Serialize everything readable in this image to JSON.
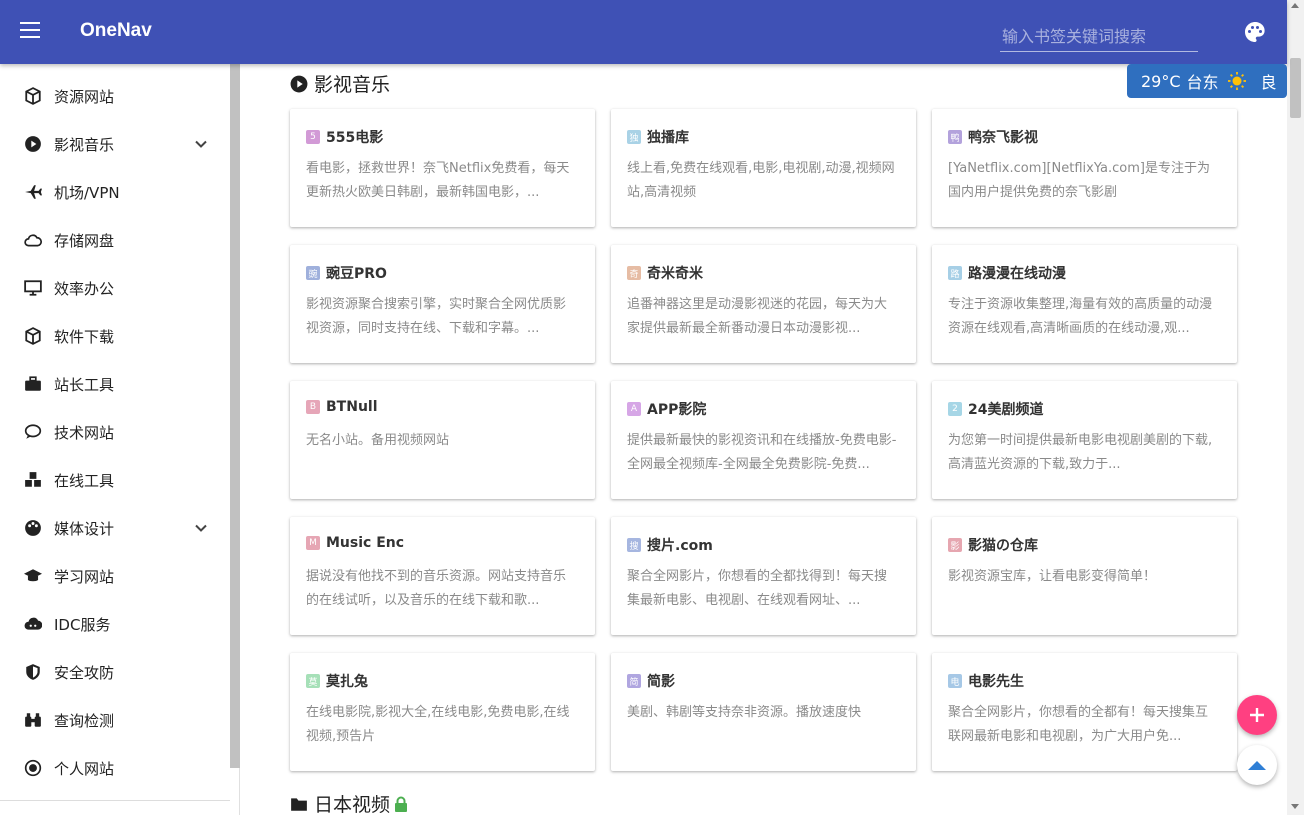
{
  "app": {
    "title": "OneNav"
  },
  "search": {
    "placeholder": "输入书签关键词搜索"
  },
  "weather": {
    "temp": "29°C",
    "location": "台东",
    "icon": "sun-icon",
    "air_quality": "良"
  },
  "sidebar": {
    "items": [
      {
        "label": "资源网站",
        "icon": "cube-icon"
      },
      {
        "label": "影视音乐",
        "icon": "play-circle-icon",
        "expandable": true
      },
      {
        "label": "机场/VPN",
        "icon": "plane-icon"
      },
      {
        "label": "存储网盘",
        "icon": "cloud-icon"
      },
      {
        "label": "效率办公",
        "icon": "monitor-icon"
      },
      {
        "label": "软件下载",
        "icon": "cube-icon"
      },
      {
        "label": "站长工具",
        "icon": "briefcase-icon"
      },
      {
        "label": "技术网站",
        "icon": "chat-bubble-icon"
      },
      {
        "label": "在线工具",
        "icon": "cubes-icon"
      },
      {
        "label": "媒体设计",
        "icon": "palette-icon",
        "expandable": true
      },
      {
        "label": "学习网站",
        "icon": "graduation-cap-icon"
      },
      {
        "label": "IDC服务",
        "icon": "cloud-server-icon"
      },
      {
        "label": "安全攻防",
        "icon": "shield-icon"
      },
      {
        "label": "查询检测",
        "icon": "binoculars-icon"
      },
      {
        "label": "个人网站",
        "icon": "radio-dot-icon"
      }
    ]
  },
  "sections": [
    {
      "title": "影视音乐",
      "icon": "play-circle-icon",
      "cards": [
        {
          "title": "555电影",
          "badge": "5",
          "color": "#d29ad6",
          "desc": "看电影，拯救世界！奈飞Netflix免费看，每天更新热火欧美日韩剧，最新韩国电影，..."
        },
        {
          "title": "独播库",
          "badge": "独",
          "color": "#a9d2e6",
          "desc": "线上看,免费在线观看,电影,电视剧,动漫,视频网站,高清视频"
        },
        {
          "title": "鸭奈飞影视",
          "badge": "鸭",
          "color": "#b3a2dc",
          "desc": "[YaNetflix.com][NetflixYa.com]是专注于为国内用户提供免费的奈飞影剧"
        },
        {
          "title": "豌豆PRO",
          "badge": "豌",
          "color": "#9fb0dc",
          "desc": "影视资源聚合搜索引擎，实时聚合全网优质影视资源，同时支持在线、下载和字幕。..."
        },
        {
          "title": "奇米奇米",
          "badge": "奇",
          "color": "#e6bca4",
          "desc": "追番神器这里是动漫影视迷的花园，每天为大家提供最新最全新番动漫日本动漫影视..."
        },
        {
          "title": "路漫漫在线动漫",
          "badge": "路",
          "color": "#a6cfe6",
          "desc": "专注于资源收集整理,海量有效的高质量的动漫资源在线观看,高清晰画质的在线动漫,观..."
        },
        {
          "title": "BTNull",
          "badge": "B",
          "color": "#e6a6b8",
          "desc": "无名小站。备用视频网站"
        },
        {
          "title": "APP影院",
          "badge": "A",
          "color": "#d6a6e6",
          "desc": "提供最新最快的影视资讯和在线播放-免费电影-全网最全视频库-全网最全免费影院-免费..."
        },
        {
          "title": "24美剧频道",
          "badge": "2",
          "color": "#a6d6e6",
          "desc": "为您第一时间提供最新电影电视剧美剧的下载,高清蓝光资源的下载,致力于..."
        },
        {
          "title": "Music Enc",
          "badge": "M",
          "color": "#e6a6b4",
          "desc": "据说没有他找不到的音乐资源。网站支持音乐的在线试听，以及音乐的在线下载和歌..."
        },
        {
          "title": "搜片.com",
          "badge": "搜",
          "color": "#a6b6e0",
          "desc": "聚合全网影片，你想看的全都找得到！每天搜集最新电影、电视剧、在线观看网址、..."
        },
        {
          "title": "影猫の仓库",
          "badge": "影",
          "color": "#e6a6b0",
          "desc": "影视资源宝库，让看电影变得简单！"
        },
        {
          "title": "莫扎兔",
          "badge": "莫",
          "color": "#a6e0b8",
          "desc": "在线电影院,影视大全,在线电影,免费电影,在线视频,预告片"
        },
        {
          "title": "简影",
          "badge": "简",
          "color": "#b0a6e0",
          "desc": "美剧、韩剧等支持奈非资源。播放速度快"
        },
        {
          "title": "电影先生",
          "badge": "电",
          "color": "#a6c8e6",
          "desc": "聚合全网影片，你想看的全都有！每天搜集互联网最新电影和电视剧，为广大用户免..."
        }
      ]
    },
    {
      "title": "日本视频",
      "icon": "folder-icon",
      "locked": true
    }
  ],
  "fab": {
    "add": "plus-icon",
    "top": "arrow-up-icon"
  },
  "colors": {
    "primary": "#3f51b5",
    "accent": "#ff4081",
    "weather_bg": "#2f6fbf"
  }
}
